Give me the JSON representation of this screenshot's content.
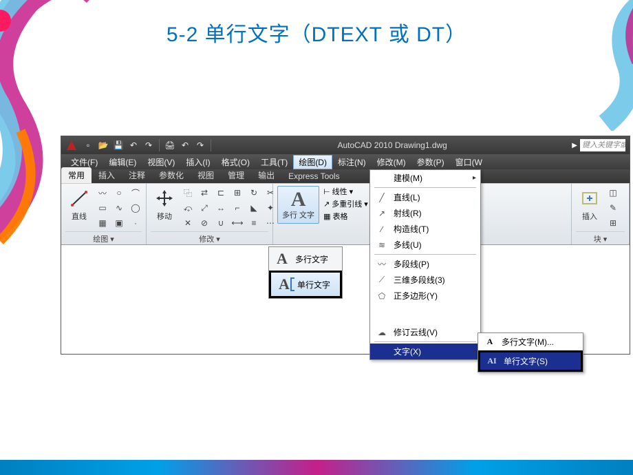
{
  "slide": {
    "title": "5-2    单行文字（DTEXT 或  DT）"
  },
  "titlebar": {
    "app_title": "AutoCAD 2010   Drawing1.dwg",
    "search_placeholder": "键入关键字或"
  },
  "menus": {
    "file": "文件(F)",
    "edit": "编辑(E)",
    "view": "视图(V)",
    "insert": "插入(I)",
    "format": "格式(O)",
    "tools": "工具(T)",
    "draw": "绘图(D)",
    "dimension": "标注(N)",
    "modify": "修改(M)",
    "parametric": "参数(P)",
    "window": "窗口(W"
  },
  "ribbon_tabs": {
    "home": "常用",
    "insert": "插入",
    "annotate": "注释",
    "parametric": "参数化",
    "view": "视图",
    "manage": "管理",
    "output": "输出",
    "express": "Express Tools"
  },
  "panels": {
    "draw": {
      "title": "绘图",
      "line_label": "直线"
    },
    "modify": {
      "title": "修改",
      "move_label": "移动"
    },
    "annotate": {
      "mtext_label": "多行\n文字",
      "linear": "线性",
      "mleader": "多重引线",
      "table": "表格"
    },
    "block": {
      "title": "块",
      "insert_label": "插入"
    }
  },
  "text_flyout": {
    "mtext": "多行文字",
    "dtext": "单行文字"
  },
  "draw_menu": {
    "modeling": "建模(M)",
    "line": "直线(L)",
    "ray": "射线(R)",
    "xline": "构造线(T)",
    "mline": "多线(U)",
    "pline": "多段线(P)",
    "3dpoly": "三维多段线(3)",
    "polygon": "正多边形(Y)",
    "revcloud": "修订云线(V)",
    "text": "文字(X)"
  },
  "text_submenu": {
    "mtext": "多行文字(M)...",
    "dtext": "单行文字(S)"
  }
}
